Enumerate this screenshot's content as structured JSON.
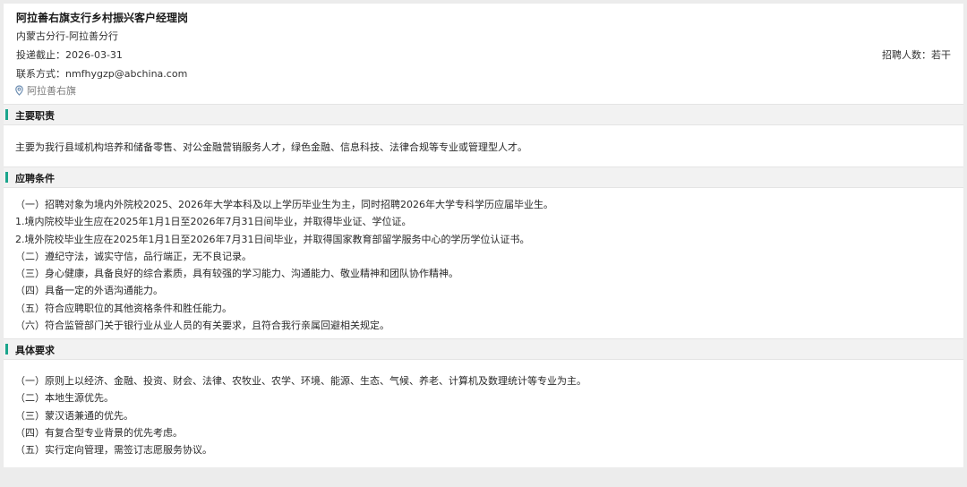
{
  "job": {
    "title": "阿拉善右旗支行乡村振兴客户经理岗",
    "branch": "内蒙古分行-阿拉善分行",
    "deadline": "投递截止：2026-03-31",
    "contact": "联系方式：nmfhygzp@abchina.com",
    "location": "阿拉善右旗",
    "recruit_count": "招聘人数：若干"
  },
  "sections": [
    {
      "title": "主要职责",
      "lines": [
        "主要为我行县域机构培养和储备零售、对公金融营销服务人才，绿色金融、信息科技、法律合规等专业或管理型人才。"
      ]
    },
    {
      "title": "应聘条件",
      "lines": [
        "（一）招聘对象为境内外院校2025、2026年大学本科及以上学历毕业生为主，同时招聘2026年大学专科学历应届毕业生。",
        "1.境内院校毕业生应在2025年1月1日至2026年7月31日间毕业，并取得毕业证、学位证。",
        "2.境外院校毕业生应在2025年1月1日至2026年7月31日间毕业，并取得国家教育部留学服务中心的学历学位认证书。",
        "（二）遵纪守法，诚实守信，品行端正，无不良记录。",
        "（三）身心健康，具备良好的综合素质，具有较强的学习能力、沟通能力、敬业精神和团队协作精神。",
        "（四）具备一定的外语沟通能力。",
        "（五）符合应聘职位的其他资格条件和胜任能力。",
        "（六）符合监管部门关于银行业从业人员的有关要求，且符合我行亲属回避相关规定。"
      ]
    },
    {
      "title": "具体要求",
      "lines": [
        "（一）原则上以经济、金融、投资、财会、法律、农牧业、农学、环境、能源、生态、气候、养老、计算机及数理统计等专业为主。",
        "（二）本地生源优先。",
        "（三）蒙汉语兼通的优先。",
        "（四）有复合型专业背景的优先考虑。",
        "（五）实行定向管理，需签订志愿服务协议。"
      ]
    }
  ],
  "colors": {
    "accent": "#1aa58c"
  },
  "icons": {
    "location": "map-pin-icon"
  }
}
